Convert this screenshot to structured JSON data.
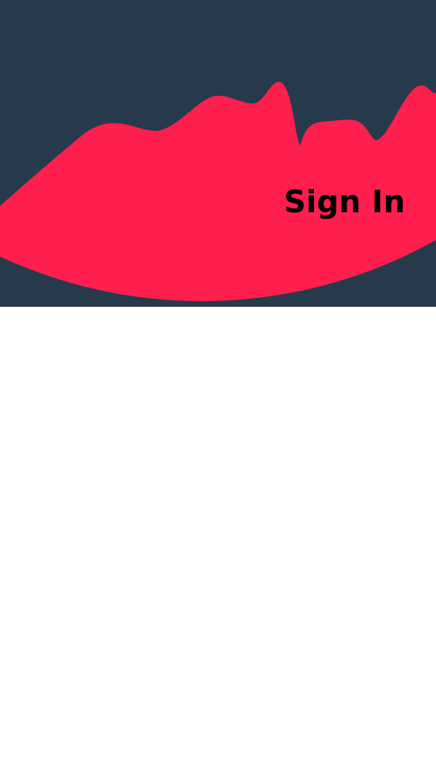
{
  "header": {
    "title": "Sign In"
  },
  "colors": {
    "dark_background": "#263a4b",
    "accent": "#ff1f4f",
    "page_background": "#ffffff",
    "title_text": "#000000"
  }
}
